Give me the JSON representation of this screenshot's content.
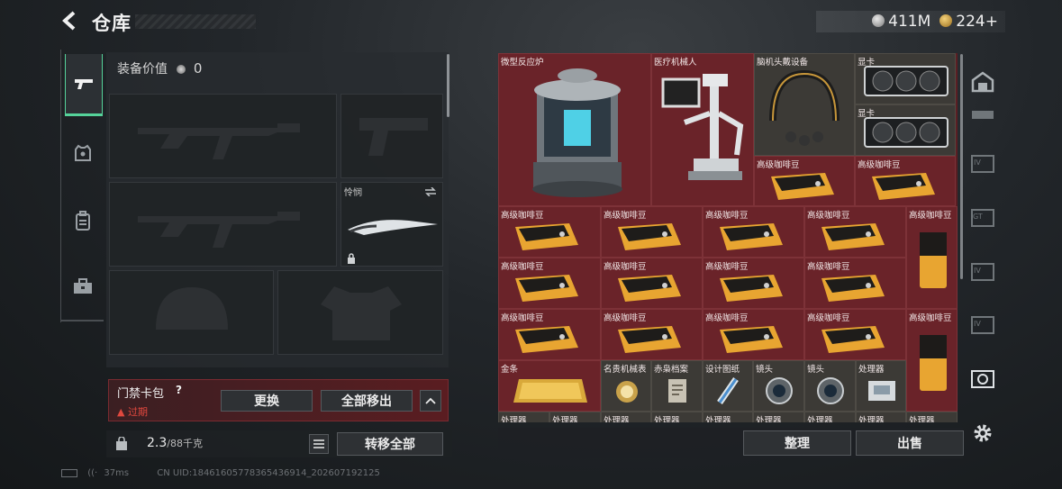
{
  "header": {
    "title": "仓库",
    "currency1": "411M",
    "currency2": "224+"
  },
  "equipment": {
    "label": "装备价值",
    "value": "0"
  },
  "knife": {
    "label": "怜悯"
  },
  "keycard": {
    "label": "门禁卡包",
    "help": "?",
    "status": "过期",
    "replace": "更换",
    "remove_all": "全部移出"
  },
  "capacity": {
    "value": "2.3",
    "max": "/88千克",
    "transfer_all": "转移全部"
  },
  "grid": {
    "reactor": "微型反应炉",
    "medbot": "医疗机械人",
    "headgear": "脑机头戴设备",
    "gpu": "显卡",
    "coffee": "高级咖啡豆",
    "gold": "金条",
    "watch": "名贵机械表",
    "archive": "赤枭档案",
    "blueprint": "设计图纸",
    "lens": "镜头",
    "processor": "处理器"
  },
  "actions": {
    "sort": "整理",
    "sell": "出售"
  },
  "status": {
    "ping": "37ms",
    "uid": "CN UID:1846160577836543691​4_202607192125"
  },
  "colors": {
    "accent": "#55d39a",
    "grid_bg": "#5b1e23",
    "warn": "#e0483e"
  }
}
